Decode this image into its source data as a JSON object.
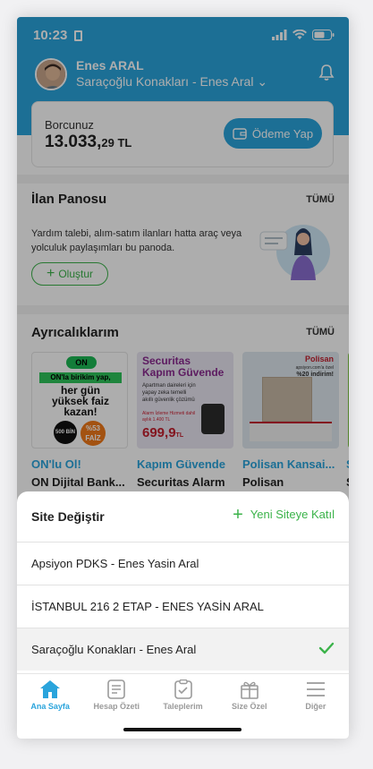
{
  "status": {
    "time": "10:23"
  },
  "header": {
    "user_name": "Enes ARAL",
    "site_name": "Saraçoğlu Konakları - Enes Aral ⌄"
  },
  "debt": {
    "label": "Borcunuz",
    "amount_main": "13.033,",
    "amount_decimal": "29 TL",
    "pay_button": "Ödeme Yap"
  },
  "board": {
    "title": "İlan Panosu",
    "all_label": "TÜMÜ",
    "description": "Yardım talebi, alım-satım ilanları hatta araç veya yolculuk paylaşımları bu panoda.",
    "create_button": "Oluştur"
  },
  "privileges": {
    "title": "Ayrıcalıklarım",
    "all_label": "TÜMÜ",
    "cards": [
      {
        "title": "ON'lu Ol!",
        "subtitle": "ON Dijital Bank...",
        "art_lines": [
          "ON'la birikim yap,",
          "her gün",
          "yüksek faiz",
          "kazan!"
        ],
        "badge1": "500 BİN TL",
        "badge2": "%53",
        "badge3": "FAİZ",
        "logo": "ON"
      },
      {
        "title": "Kapım Güvende",
        "subtitle": "Securitas Alarm",
        "art_lines": [
          "Securitas",
          "Kapım Güvende"
        ],
        "art_small": "Apartman daireleri için yapay zeka temelli akıllı güvenlik çözümü",
        "price_label": "Alarm İzleme Hizmeti dahil aylık 1.400 TL",
        "price": "699,9",
        "price_unit": "TL"
      },
      {
        "title": "Polisan Kansai...",
        "subtitle": "Polisan",
        "logo": "Polisan",
        "art_small": "apsiyon.com'a özel",
        "discount": "%20 indirim!"
      },
      {
        "title": "S",
        "subtitle": "S"
      }
    ]
  },
  "sheet": {
    "title": "Site Değiştir",
    "new_site": "Yeni Siteye Katıl",
    "sites": [
      {
        "label": "Apsiyon PDKS - Enes Yasin Aral",
        "selected": false
      },
      {
        "label": "İSTANBUL 216 2 ETAP - ENES YASİN ARAL",
        "selected": false
      },
      {
        "label": "Saraçoğlu Konakları - Enes Aral",
        "selected": true
      }
    ]
  },
  "tabbar": {
    "items": [
      {
        "label": "Ana Sayfa",
        "icon": "home-icon",
        "active": true
      },
      {
        "label": "Hesap Özeti",
        "icon": "document-icon",
        "active": false
      },
      {
        "label": "Taleplerim",
        "icon": "clipboard-icon",
        "active": false
      },
      {
        "label": "Size Özel",
        "icon": "gift-icon",
        "active": false
      },
      {
        "label": "Diğer",
        "icon": "menu-icon",
        "active": false
      }
    ]
  },
  "colors": {
    "brand": "#2aa4dc",
    "green": "#3bb34a"
  }
}
